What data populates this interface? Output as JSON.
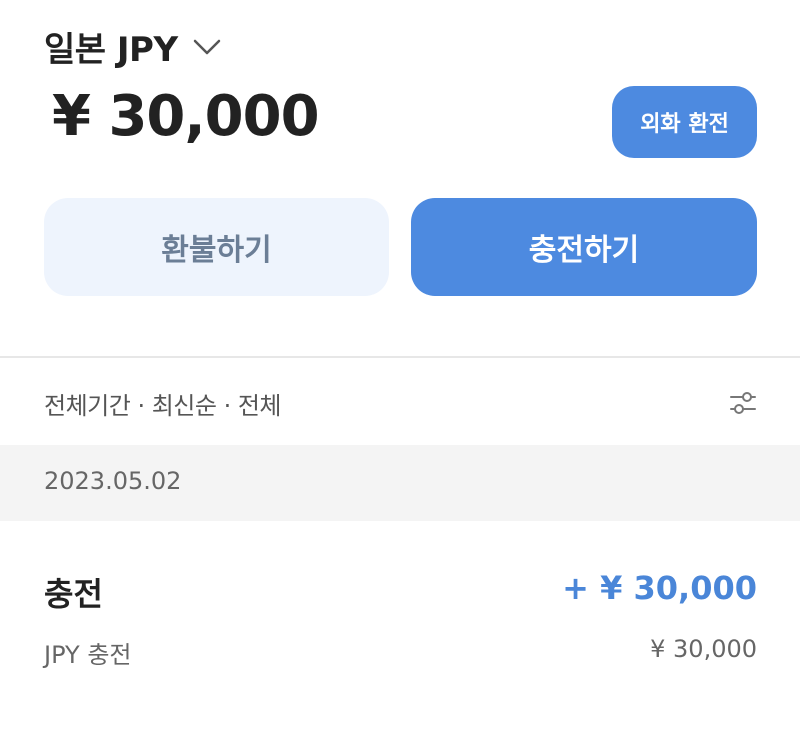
{
  "header": {
    "currency_label": "일본 JPY",
    "balance": "¥ 30,000",
    "exchange_button": "외화 환전"
  },
  "actions": {
    "refund_label": "환불하기",
    "charge_label": "충전하기"
  },
  "filter": {
    "summary": "전체기간 · 최신순 · 전체"
  },
  "history": {
    "date": "2023.05.02",
    "items": [
      {
        "title": "충전",
        "amount": "+ ¥ 30,000",
        "subtitle": "JPY 충전",
        "sub_amount": "¥ 30,000"
      }
    ]
  },
  "colors": {
    "accent": "#4d8ae0",
    "amount_positive": "#4a86d8",
    "refund_bg": "#eef4fd",
    "refund_text": "#6b7e96",
    "date_band": "#f4f4f4"
  },
  "icons": {
    "currency_dropdown": "chevron-down-icon",
    "filter": "sliders-icon"
  }
}
